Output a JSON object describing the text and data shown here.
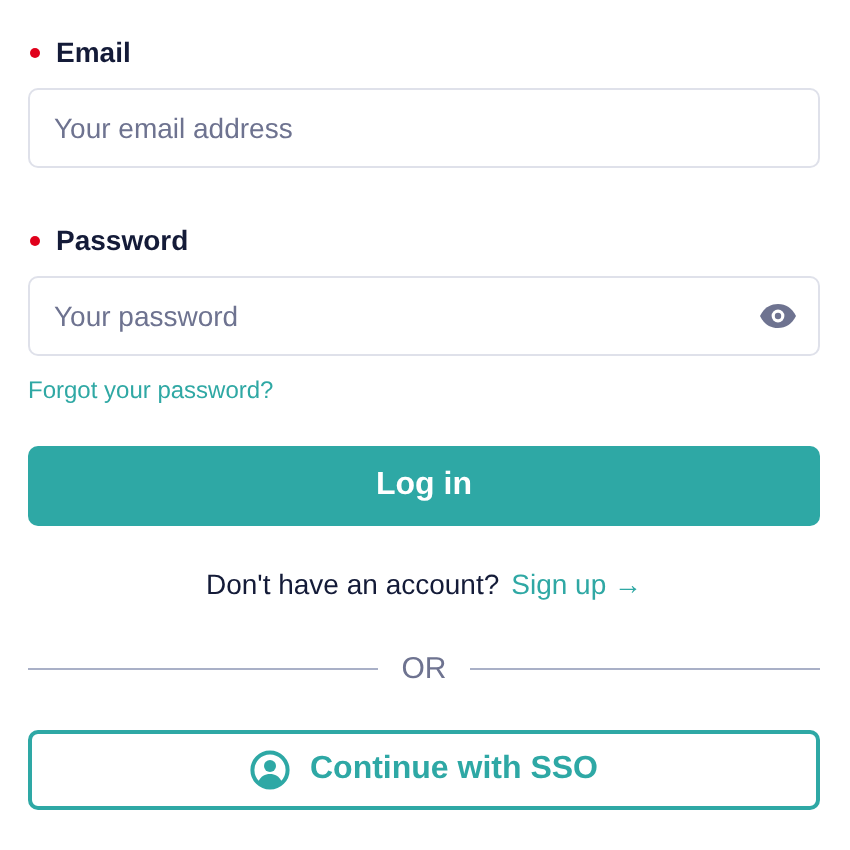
{
  "fields": [
    {
      "label": "Email",
      "required": true,
      "placeholder": "Your email address",
      "kind": "email"
    },
    {
      "label": "Password",
      "required": true,
      "placeholder": "Your password",
      "kind": "password"
    }
  ],
  "forgot_link": "Forgot your password?",
  "login_button": "Log in",
  "signup": {
    "prompt": "Don't have an account?",
    "link": "Sign up →"
  },
  "divider": "OR",
  "sso_button": "Continue with SSO"
}
